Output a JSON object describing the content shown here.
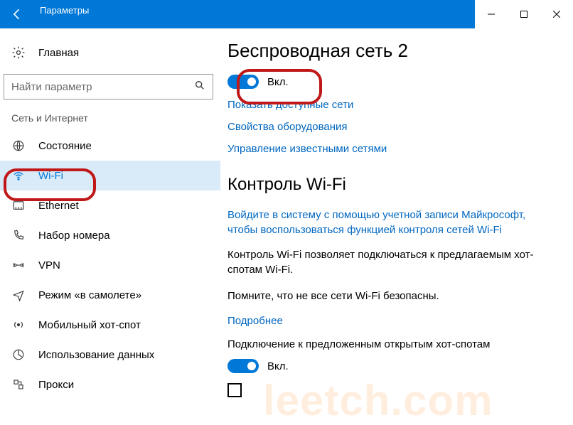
{
  "window": {
    "title": "Параметры"
  },
  "sidebar": {
    "home": "Главная",
    "search_placeholder": "Найти параметр",
    "section": "Сеть и Интернет",
    "items": [
      {
        "label": "Состояние"
      },
      {
        "label": "Wi-Fi"
      },
      {
        "label": "Ethernet"
      },
      {
        "label": "Набор номера"
      },
      {
        "label": "VPN"
      },
      {
        "label": "Режим «в самолете»"
      },
      {
        "label": "Мобильный хот-спот"
      },
      {
        "label": "Использование данных"
      },
      {
        "label": "Прокси"
      }
    ]
  },
  "main": {
    "heading1": "Беспроводная сеть 2",
    "toggle1_label": "Вкл.",
    "link_show_networks": "Показать доступные сети",
    "link_hw_props": "Свойства оборудования",
    "link_known_nets": "Управление известными сетями",
    "heading2": "Контроль Wi-Fi",
    "link_signin": "Войдите в систему с помощью учетной записи Майкрософт, чтобы воспользоваться функцией контроля сетей Wi-Fi",
    "body1": "Контроль Wi-Fi позволяет подключаться к предлагаемым хот-спотам Wi-Fi.",
    "body2": "Помните, что не все сети Wi-Fi безопасны.",
    "link_more": "Подробнее",
    "body3": "Подключение к предложенным открытым хот-спотам",
    "toggle2_label": "Вкл."
  },
  "watermark": "leetch.com"
}
